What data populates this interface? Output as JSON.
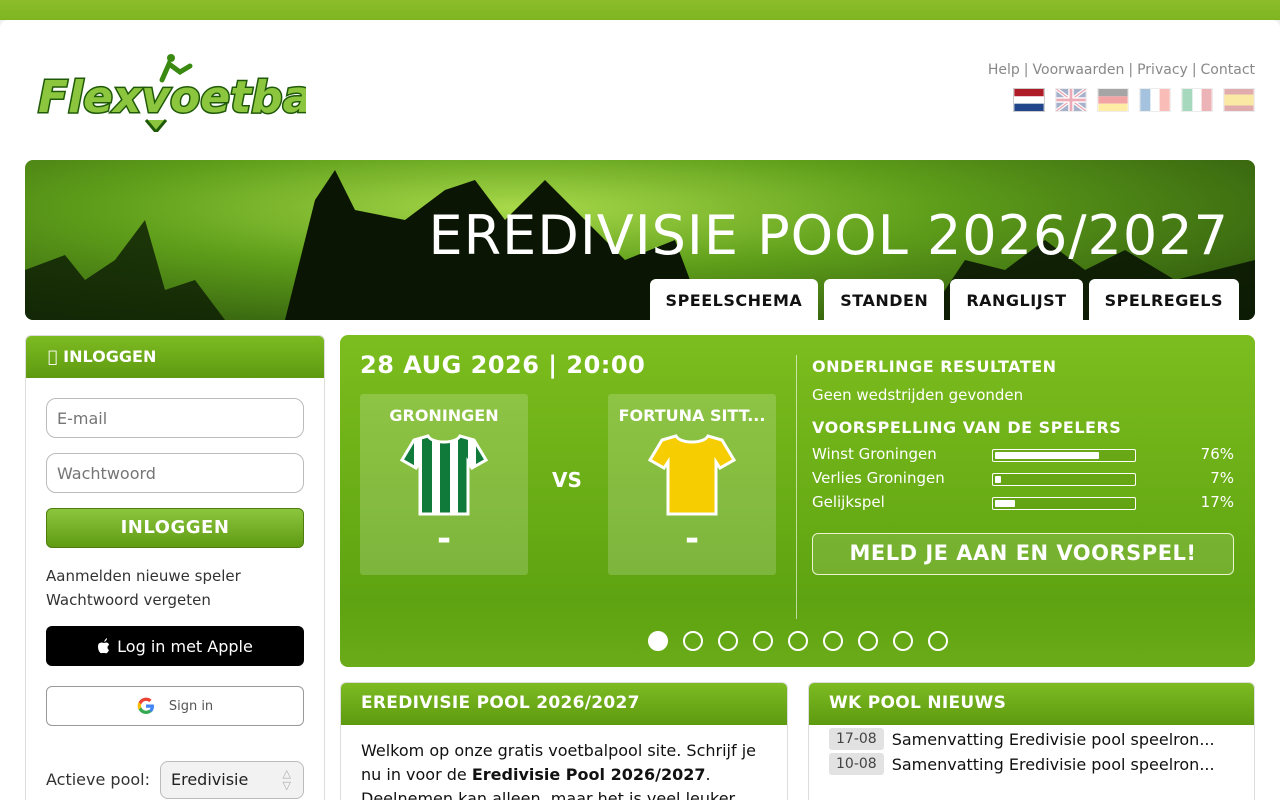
{
  "header": {
    "logo_text": "Flexvoetbal",
    "links": [
      "Help",
      "Voorwaarden",
      "Privacy",
      "Contact"
    ],
    "flags": [
      "nl-flag",
      "uk-flag",
      "de-flag",
      "fr-flag",
      "it-flag",
      "es-flag"
    ]
  },
  "banner": {
    "title": "EREDIVISIE POOL 2026/2027",
    "tabs": [
      "SPEELSCHEMA",
      "STANDEN",
      "RANGLIJST",
      "SPELREGELS"
    ]
  },
  "login": {
    "heading": " INLOGGEN",
    "email_placeholder": "E-mail",
    "password_placeholder": "Wachtwoord",
    "login_button": "INLOGGEN",
    "register_link": "Aanmelden nieuwe speler",
    "forgot_link": "Wachtwoord vergeten",
    "apple_button": "Log in met Apple",
    "google_button": "Sign in",
    "active_pool_label": "Actieve pool:",
    "active_pool_value": "Eredivisie"
  },
  "match": {
    "date": "28 AUG 2026 | 20:00",
    "home_team": "GRONINGEN",
    "away_team": "FORTUNA SITT...",
    "home_score": "-",
    "away_score": "-",
    "vs": "VS",
    "h2h_title": "ONDERLINGE RESULTATEN",
    "h2h_text": "Geen wedstrijden gevonden",
    "predictions_title": "VOORSPELLING VAN DE SPELERS",
    "predictions": [
      {
        "label": "Winst Groningen",
        "percent": 76,
        "text": "76%"
      },
      {
        "label": "Verlies Groningen",
        "percent": 7,
        "text": "7%"
      },
      {
        "label": "Gelijkspel",
        "percent": 17,
        "text": "17%"
      }
    ],
    "signup_button": "MELD JE AAN EN VOORSPEL!",
    "slides": 9,
    "active_slide": 0
  },
  "pool_panel": {
    "title": "EREDIVISIE POOL 2026/2027",
    "intro_1": "Welkom op onze gratis voetbalpool site. Schrijf je nu in voor de ",
    "intro_bold": "Eredivisie Pool 2026/2027",
    "intro_2": ". Deelnemen kan alleen, maar het is veel leuker"
  },
  "news_panel": {
    "title": "WK POOL NIEUWS",
    "items": [
      {
        "date": "17-08",
        "text": "Samenvatting Eredivisie pool speelron..."
      },
      {
        "date": "10-08",
        "text": "Samenvatting Eredivisie pool speelron..."
      }
    ]
  },
  "colors": {
    "brand_green": "#6aab18",
    "dark_green": "#2f6b0c",
    "groningen_shirt": "#0f7a3a",
    "fortuna_shirt": "#f6cd00"
  }
}
